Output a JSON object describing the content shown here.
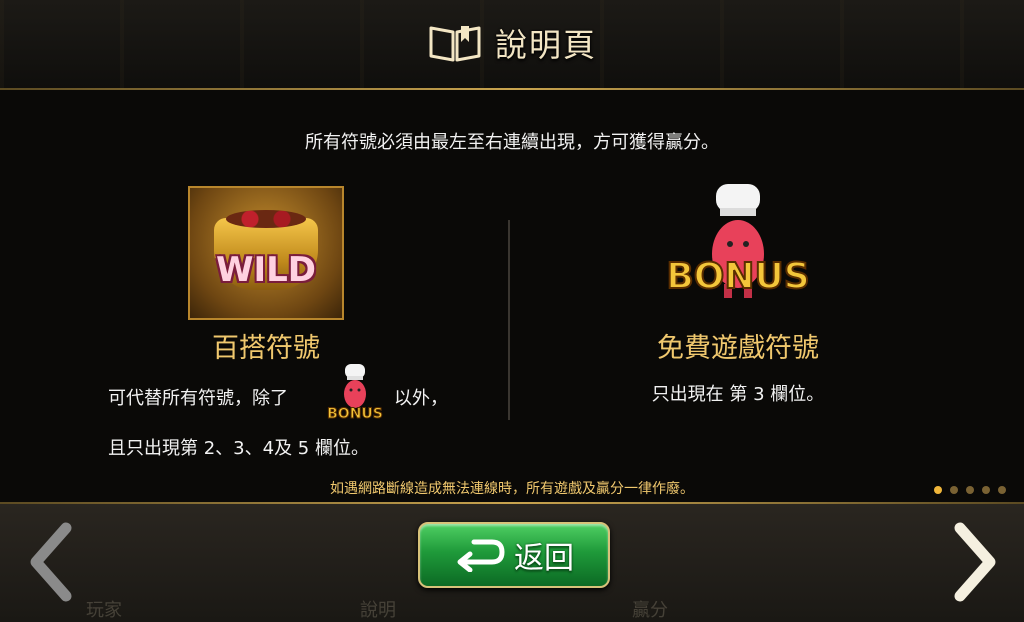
{
  "header": {
    "title": "說明頁",
    "icon": "book-icon"
  },
  "main": {
    "rule_text": "所有符號必須由最左至右連續出現，方可獲得贏分。",
    "wild": {
      "image_text": "WILD",
      "title": "百搭符號",
      "desc_line1_start": "可代替所有符號，除了",
      "desc_line1_end": "以外，",
      "inline_icon_text": "BONUS",
      "desc_line2": "且只出現第 2、3、4及 5 欄位。"
    },
    "bonus": {
      "image_text": "BONUS",
      "title": "免費遊戲符號",
      "desc": "只出現在 第 3 欄位。"
    },
    "disclaimer": "如遇網路斷線造成無法連線時，所有遊戲及贏分一律作廢。",
    "pagination": {
      "total": 5,
      "current": 1
    }
  },
  "footer": {
    "back_label": "返回",
    "back_icon": "return-arrow-icon",
    "prev_icon": "chevron-left-icon",
    "next_icon": "chevron-right-icon",
    "tabs": [
      "玩家",
      "說明",
      "贏分"
    ]
  },
  "colors": {
    "accent_gold": "#f0c86e",
    "button_green": "#1f9a3a",
    "dot_active": "#f0b63a",
    "dot_inactive": "#7a6233"
  }
}
